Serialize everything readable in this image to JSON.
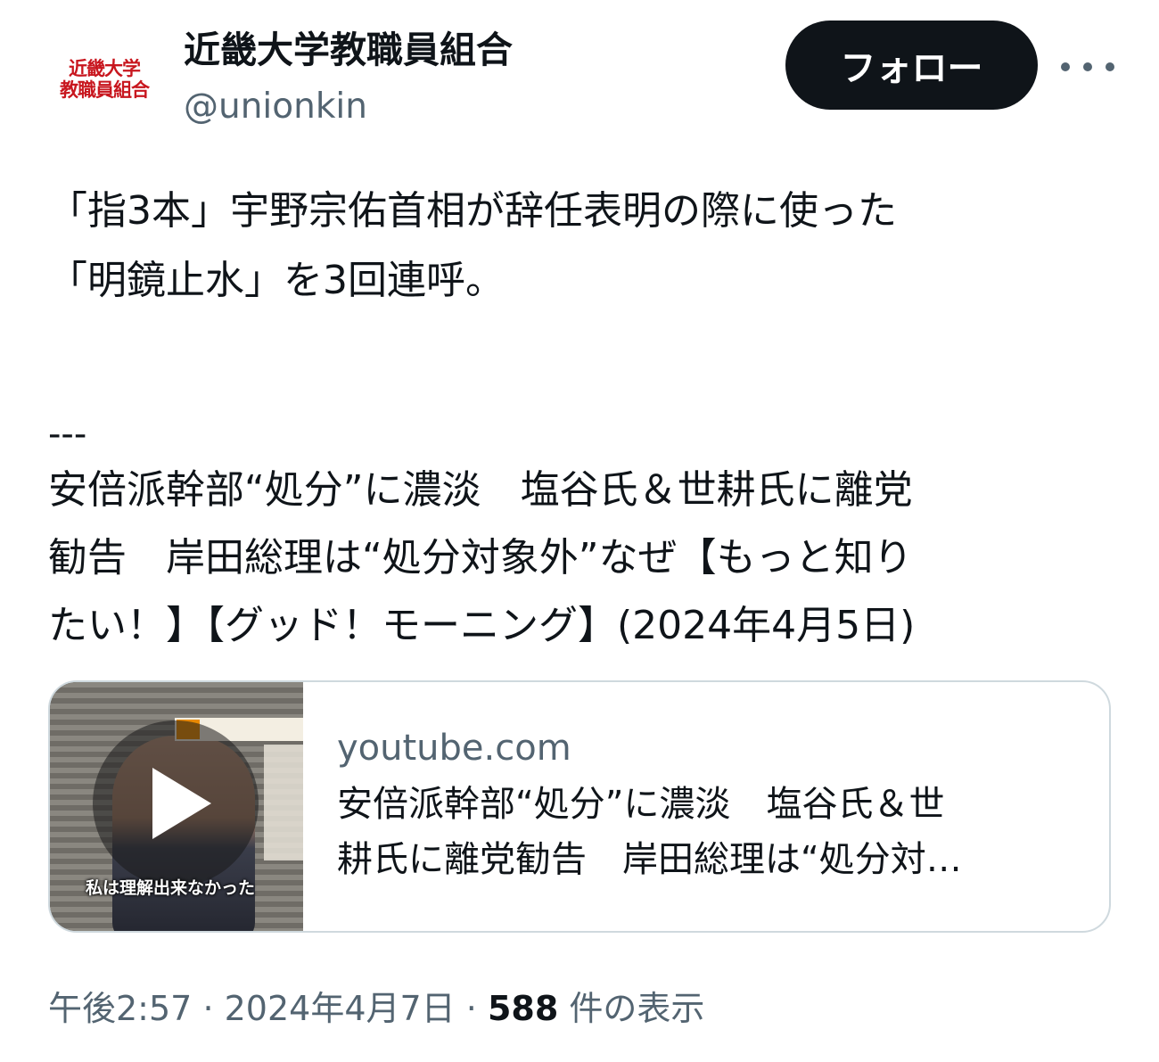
{
  "author": {
    "avatar_text": [
      "近畿大学",
      "教職員組合"
    ],
    "display_name": "近畿大学教職員組合",
    "handle": "@unionkin",
    "follow_label": "フォロー",
    "more_icon": "more-horizontal-icon"
  },
  "tweet": {
    "lines": [
      "「指3本」宇野宗佑首相が辞任表明の際に使った",
      "「明鏡止水」を3回連呼。"
    ],
    "separator": "---",
    "quote_lines": [
      "安倍派幹部“処分”に濃淡　塩谷氏＆世耕氏に離党",
      "勧告　岸田総理は“処分対象外”なぜ【もっと知り",
      "たい！】【グッド！モーニング】(2024年4月5日)"
    ]
  },
  "card": {
    "domain": "youtube.com",
    "title_lines": [
      "安倍派幹部“処分”に濃淡　塩谷氏＆世",
      "耕氏に離党勧告　岸田総理は“処分対…"
    ],
    "thumbnail_caption": "私は理解出来なかった",
    "play_icon": "play-icon"
  },
  "meta": {
    "time": "午後2:57",
    "date": "2024年4月7日",
    "dot": "·",
    "views_count": "588",
    "views_label": "件の表示"
  }
}
